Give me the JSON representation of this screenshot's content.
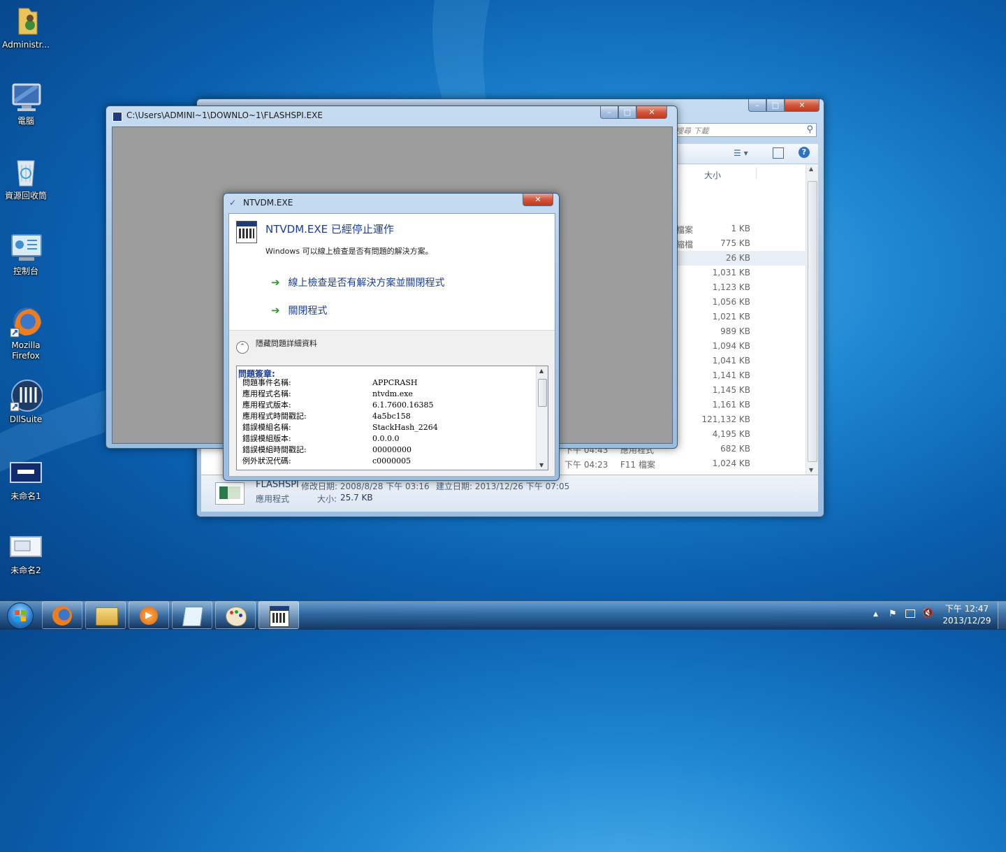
{
  "desktop_icons": [
    {
      "label": "Administr...",
      "icon": "user-folder-icon"
    },
    {
      "label": "電腦",
      "icon": "computer-icon"
    },
    {
      "label": "資源回收筒",
      "icon": "recycle-bin-icon"
    },
    {
      "label": "控制台",
      "icon": "control-panel-icon"
    },
    {
      "label": "Mozilla\nFirefox",
      "icon": "firefox-icon"
    },
    {
      "label": "DllSuite",
      "icon": "dllsuite-icon"
    },
    {
      "label": "未命名1",
      "icon": "document-icon"
    },
    {
      "label": "未命名2",
      "icon": "document-icon"
    }
  ],
  "explorer": {
    "search_placeholder": "搜尋 下載",
    "column_size": "大小",
    "rows": [
      {
        "type": "檔案",
        "size": "1 KB",
        "date": ""
      },
      {
        "type": "縮檔",
        "size": "775 KB",
        "date": ""
      },
      {
        "type": "",
        "size": "26 KB",
        "date": ""
      },
      {
        "type": "",
        "size": "1,031 KB",
        "date": ""
      },
      {
        "type": "",
        "size": "1,123 KB",
        "date": ""
      },
      {
        "type": "",
        "size": "1,056 KB",
        "date": ""
      },
      {
        "type": "",
        "size": "1,021 KB",
        "date": ""
      },
      {
        "type": "",
        "size": "989 KB",
        "date": ""
      },
      {
        "type": "",
        "size": "1,094 KB",
        "date": ""
      },
      {
        "type": "",
        "size": "1,041 KB",
        "date": ""
      },
      {
        "type": "",
        "size": "1,141 KB",
        "date": ""
      },
      {
        "type": "",
        "size": "1,145 KB",
        "date": ""
      },
      {
        "type": "",
        "size": "1,161 KB",
        "date": ""
      },
      {
        "type": "",
        "size": "121,132 KB",
        "date": ""
      },
      {
        "type": "",
        "size": "4,195 KB",
        "date": ""
      },
      {
        "type": "應用程式",
        "size": "682 KB",
        "date": "下午 04:43"
      },
      {
        "type": "F11 檔案",
        "size": "1,024 KB",
        "date": "下午 04:23"
      }
    ],
    "details": {
      "name": "FLASHSPI",
      "modified": "修改日期: 2008/8/28 下午 03:16",
      "created": "建立日期: 2013/12/26 下午 07:05",
      "type": "應用程式",
      "size_label": "大小:",
      "size": "25.7 KB"
    }
  },
  "console": {
    "title": "C:\\Users\\ADMINI~1\\DOWNLO~1\\FLASHSPI.EXE"
  },
  "dialog": {
    "title": "NTVDM.EXE",
    "heading": "NTVDM.EXE 已經停止運作",
    "subtext": "Windows 可以線上檢查是否有問題的解決方案。",
    "option1": "線上檢查是否有解決方案並關閉程式",
    "option2": "關閉程式",
    "toggle_label": "隱藏問題詳細資料",
    "details_header": "問題簽章:",
    "details": [
      {
        "k": "問題事件名稱:",
        "v": "APPCRASH"
      },
      {
        "k": "應用程式名稱:",
        "v": "ntvdm.exe"
      },
      {
        "k": "應用程式版本:",
        "v": "6.1.7600.16385"
      },
      {
        "k": "應用程式時間戳記:",
        "v": "4a5bc158"
      },
      {
        "k": "錯誤模組名稱:",
        "v": "StackHash_2264"
      },
      {
        "k": "錯誤模組版本:",
        "v": "0.0.0.0"
      },
      {
        "k": "錯誤模組時間戳記:",
        "v": "00000000"
      },
      {
        "k": "例外狀況代碼:",
        "v": "c0000005"
      }
    ]
  },
  "taskbar": {
    "clock_time": "下午 12:47",
    "clock_date": "2013/12/29",
    "buttons": [
      "start-orb-icon",
      "firefox-icon",
      "explorer-icon",
      "media-player-icon",
      "notepad-icon",
      "paint-icon",
      "console-app-icon"
    ]
  }
}
